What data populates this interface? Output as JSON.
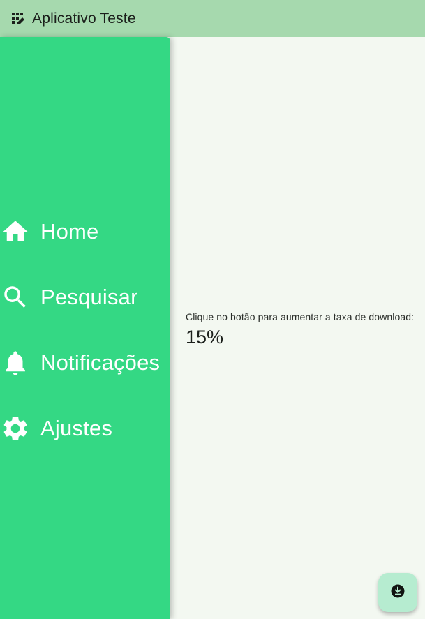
{
  "app_bar": {
    "title": "Aplicativo Teste",
    "icon": "dashboard-edit-icon"
  },
  "drawer": {
    "items": [
      {
        "label": "Home",
        "icon": "home-icon"
      },
      {
        "label": "Pesquisar",
        "icon": "search-icon"
      },
      {
        "label": "Notificações",
        "icon": "bell-icon"
      },
      {
        "label": "Ajustes",
        "icon": "gear-icon"
      }
    ]
  },
  "main": {
    "hint": "Clique no botão para aumentar a taxa de download:",
    "value": "15%"
  },
  "fab": {
    "icon": "download-icon"
  },
  "colors": {
    "app_bar": "#a6d9ae",
    "drawer": "#34d884",
    "background": "#f3f8f1",
    "fab": "#b6ecd0"
  }
}
